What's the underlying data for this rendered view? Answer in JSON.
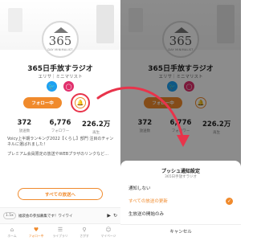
{
  "channel": {
    "logo_text": "365",
    "logo_subtext": "DAY MINIMALIST",
    "title": "365日手放すラジオ",
    "subtitle": "エリサ｜ミニマリスト"
  },
  "actions": {
    "follow_label": "フォロー中",
    "social_icons": [
      "twitter-icon",
      "instagram-icon"
    ],
    "bell_icon": "bell-icon"
  },
  "stats": [
    {
      "value": "372",
      "label": "放送数"
    },
    {
      "value": "6,776",
      "label": "フォロワー"
    },
    {
      "value": "226.2万",
      "label": "再生"
    }
  ],
  "description": [
    "Voicy上半期ランキング2022【くらし】部門 注目のチャンネルに選ばれました！",
    "プレミアム会員限定の放送やWEBプラザのリンクなど…"
  ],
  "all_broadcasts_label": "すべての放送へ",
  "player": {
    "speed": "1.5x",
    "text": "福袋会の参加募集です！ワイワイ"
  },
  "tabs": [
    {
      "label": "ホーム",
      "icon": "home-icon"
    },
    {
      "label": "フォロー中",
      "icon": "follow-icon"
    },
    {
      "label": "ライブラリ",
      "icon": "library-icon"
    },
    {
      "label": "さがす",
      "icon": "search-icon"
    },
    {
      "label": "マイページ",
      "icon": "user-icon"
    }
  ],
  "sheet": {
    "title": "プッシュ通知設定",
    "subtitle": "365日手放すラジオ",
    "options": [
      {
        "label": "通知しない",
        "selected": false
      },
      {
        "label": "すべての放送の更新",
        "selected": true
      },
      {
        "label": "生放送の開始のみ",
        "selected": false
      }
    ],
    "cancel_label": "キャンセル"
  },
  "colors": {
    "accent": "#f08a2c",
    "annotation": "#e8344b",
    "twitter": "#1da1f2",
    "instagram": "#e1306c"
  }
}
